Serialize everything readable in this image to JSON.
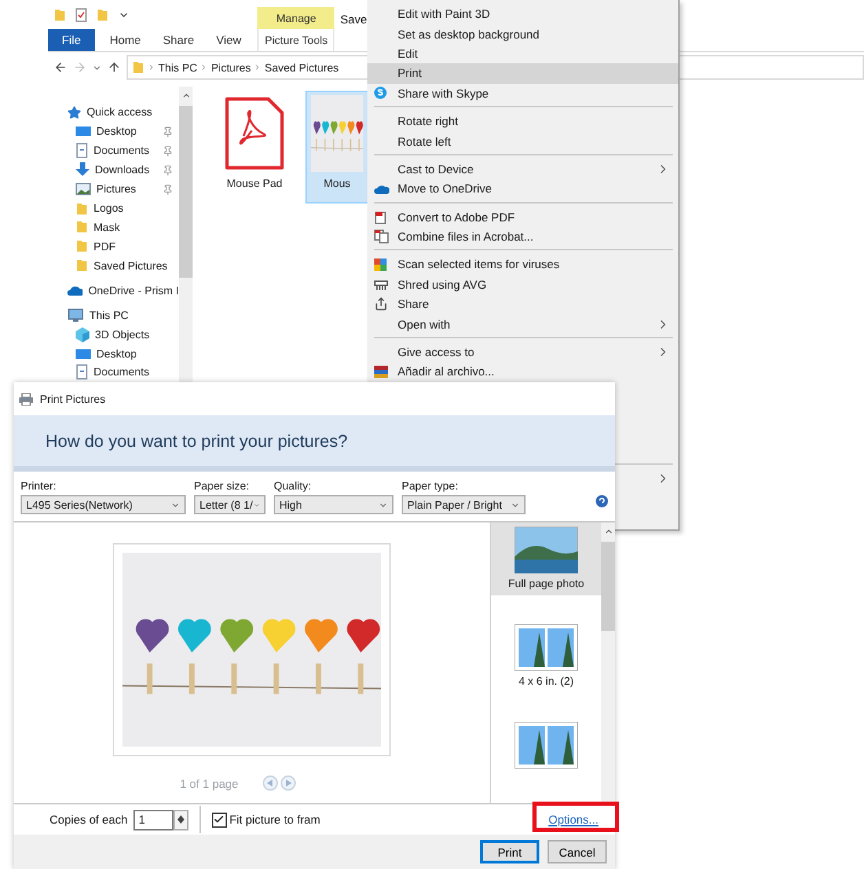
{
  "explorer": {
    "title": "Save",
    "ribbon_tabs": [
      {
        "label": "File",
        "kind": "file"
      },
      {
        "label": "Home",
        "kind": "tab"
      },
      {
        "label": "Share",
        "kind": "tab"
      },
      {
        "label": "View",
        "kind": "tab"
      },
      {
        "label": "Picture Tools",
        "kind": "context",
        "group": "Manage"
      }
    ],
    "breadcrumb": [
      "This PC",
      "Pictures",
      "Saved Pictures"
    ],
    "nav": [
      {
        "label": "Quick access",
        "kind": "star",
        "pinned": false,
        "children": [
          {
            "label": "Desktop",
            "kind": "desktop",
            "pinned": true
          },
          {
            "label": "Documents",
            "kind": "documents",
            "pinned": true
          },
          {
            "label": "Downloads",
            "kind": "downloads",
            "pinned": true
          },
          {
            "label": "Pictures",
            "kind": "pictures",
            "pinned": true
          },
          {
            "label": "Logos",
            "kind": "folder",
            "pinned": false
          },
          {
            "label": "Mask",
            "kind": "folder",
            "pinned": false
          },
          {
            "label": "PDF",
            "kind": "folder",
            "pinned": false
          },
          {
            "label": "Saved Pictures",
            "kind": "folder",
            "pinned": false
          }
        ]
      },
      {
        "label": "OneDrive - Prism I",
        "kind": "cloud",
        "pinned": false
      },
      {
        "label": "This PC",
        "kind": "pc",
        "pinned": false,
        "children": [
          {
            "label": "3D Objects",
            "kind": "objects",
            "pinned": false
          },
          {
            "label": "Desktop",
            "kind": "desktop",
            "pinned": false
          },
          {
            "label": "Documents",
            "kind": "documents",
            "pinned": false
          }
        ]
      }
    ],
    "files": [
      {
        "name": "Mouse Pad",
        "kind": "pdf",
        "selected": false
      },
      {
        "name": "Mous",
        "kind": "photo",
        "selected": true
      }
    ]
  },
  "context_menu": {
    "items": [
      {
        "label": "Edit with Paint 3D",
        "kind": "plain",
        "submenu": false,
        "selected": false
      },
      {
        "label": "Set as desktop background",
        "kind": "plain",
        "submenu": false,
        "selected": false
      },
      {
        "label": "Edit",
        "kind": "plain",
        "submenu": false,
        "selected": false
      },
      {
        "label": "Print",
        "kind": "plain",
        "submenu": false,
        "selected": true
      },
      {
        "label": "Share with Skype",
        "kind": "skype",
        "submenu": false,
        "selected": false
      },
      {
        "kind": "separator"
      },
      {
        "label": "Rotate right",
        "kind": "plain",
        "submenu": false,
        "selected": false
      },
      {
        "label": "Rotate left",
        "kind": "plain",
        "submenu": false,
        "selected": false
      },
      {
        "kind": "separator"
      },
      {
        "label": "Cast to Device",
        "kind": "plain",
        "submenu": true,
        "selected": false
      },
      {
        "label": "Move to OneDrive",
        "kind": "cloud",
        "submenu": false,
        "selected": false
      },
      {
        "kind": "separator"
      },
      {
        "label": "Convert to Adobe PDF",
        "kind": "pdf",
        "submenu": false,
        "selected": false
      },
      {
        "label": "Combine files in Acrobat...",
        "kind": "combine",
        "submenu": false,
        "selected": false
      },
      {
        "kind": "separator"
      },
      {
        "label": "Scan selected items for viruses",
        "kind": "scan",
        "submenu": false,
        "selected": false
      },
      {
        "label": "Shred using AVG",
        "kind": "shred",
        "submenu": false,
        "selected": false
      },
      {
        "label": "Share",
        "kind": "share",
        "submenu": false,
        "selected": false
      },
      {
        "label": "Open with",
        "kind": "plain",
        "submenu": true,
        "selected": false
      },
      {
        "kind": "separator"
      },
      {
        "label": "Give access to",
        "kind": "plain",
        "submenu": true,
        "selected": false
      },
      {
        "label": "Añadir al archivo...",
        "kind": "archive",
        "submenu": false,
        "selected": false
      },
      {
        "kind": "gap"
      },
      {
        "kind": "separator"
      },
      {
        "kind": "covered",
        "submenu": true,
        "selected": false
      }
    ]
  },
  "print_dialog": {
    "title": "Print Pictures",
    "heading": "How do you want to print your pictures?",
    "fields": [
      {
        "label": "Printer:",
        "value": "L495 Series(Network)"
      },
      {
        "label": "Paper size:",
        "value": "Letter (8 1/"
      },
      {
        "label": "Quality:",
        "value": "High"
      },
      {
        "label": "Paper type:",
        "value": "Plain Paper / Bright"
      }
    ],
    "pager": "1 of 1 page",
    "layouts": [
      {
        "label": "Full page photo",
        "kind": "single",
        "selected": true
      },
      {
        "label": "4 x 6 in. (2)",
        "kind": "double",
        "selected": false
      },
      {
        "kind": "double",
        "selected": false
      }
    ],
    "copies": {
      "label": "Copies of each",
      "value": "1"
    },
    "fit": {
      "label": "Fit picture to fram",
      "checked": true
    },
    "options": {
      "label": "Options...",
      "highlighted": true
    },
    "buttons": [
      {
        "label": "Print",
        "default": true
      },
      {
        "label": "Cancel",
        "default": false
      }
    ]
  }
}
